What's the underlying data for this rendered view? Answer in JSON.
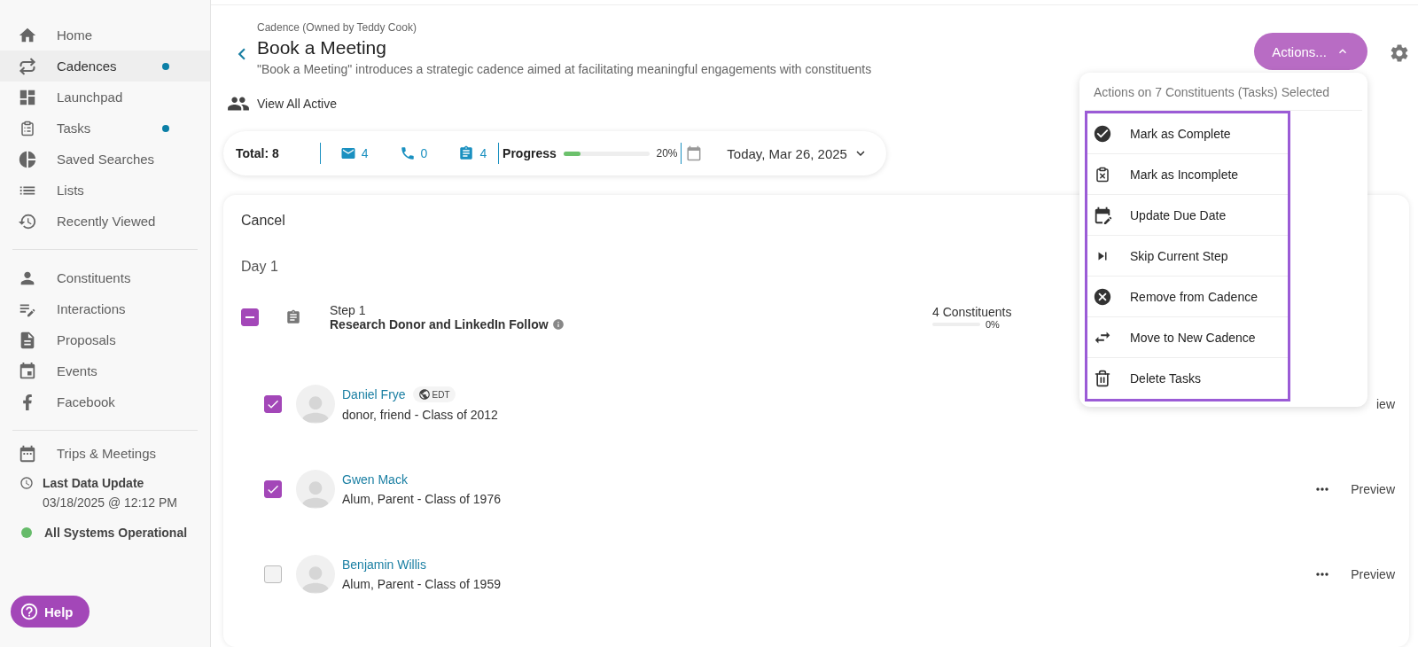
{
  "sidebar": {
    "items": [
      {
        "label": "Home",
        "selected": false,
        "dot": false
      },
      {
        "label": "Cadences",
        "selected": true,
        "dot": true
      },
      {
        "label": "Launchpad",
        "selected": false,
        "dot": false
      },
      {
        "label": "Tasks",
        "selected": false,
        "dot": true
      },
      {
        "label": "Saved Searches",
        "selected": false,
        "dot": false
      },
      {
        "label": "Lists",
        "selected": false,
        "dot": false
      },
      {
        "label": "Recently Viewed",
        "selected": false,
        "dot": false
      }
    ],
    "items_2": [
      {
        "label": "Constituents",
        "selected": false
      },
      {
        "label": "Interactions",
        "selected": false
      },
      {
        "label": "Proposals",
        "selected": false
      },
      {
        "label": "Events",
        "selected": false
      },
      {
        "label": "Facebook",
        "selected": false
      },
      {
        "label": "Trips & Meetings",
        "selected": false
      }
    ],
    "last_update": {
      "title": "Last Data Update",
      "value": "03/18/2025 @ 12:12 PM"
    },
    "system_status": {
      "label": "All Systems Operational",
      "color": "#66bb6a"
    },
    "help": "Help"
  },
  "header": {
    "owner": "Cadence (Owned by Teddy Cook)",
    "title": "Book a Meeting",
    "description": "\"Book a Meeting\" introduces a strategic cadence aimed at facilitating meaningful engagements with constituents",
    "view_all": "View All Active",
    "actions": "Actions..."
  },
  "stats": {
    "total": "Total: 8",
    "email": "4",
    "phone": "0",
    "tasks": "4",
    "progress_label": "Progress",
    "level": 0.2,
    "progress": "20%",
    "date": "Today, Mar 26, 2025"
  },
  "card": {
    "cancel": "Cancel",
    "day": "Day 1",
    "step": {
      "number": "Step 1",
      "title": "Research Donor and LinkedIn Follow",
      "indeterminate": true,
      "count": "4 Constituents",
      "level": 0,
      "percent": "0%"
    },
    "rows": [
      {
        "name": "Daniel Frye",
        "timezone": "EDT",
        "detail": "donor, friend - Class of 2012",
        "checked": true,
        "more": false,
        "preview": "iew"
      },
      {
        "name": "Gwen Mack",
        "detail": "Alum, Parent - Class of 1976",
        "checked": true,
        "more": true,
        "preview": "Preview"
      },
      {
        "name": "Benjamin Willis",
        "detail": "Alum, Parent - Class of 1959",
        "checked": false,
        "more": true,
        "preview": "Preview"
      }
    ]
  },
  "menu": {
    "header": "Actions on 7 Constituents (Tasks) Selected",
    "highlighted": true,
    "items": [
      "Mark as Complete",
      "Mark as Incomplete",
      "Update Due Date",
      "Skip Current Step",
      "Remove from Cadence",
      "Move to New Cadence",
      "Delete Tasks"
    ]
  }
}
